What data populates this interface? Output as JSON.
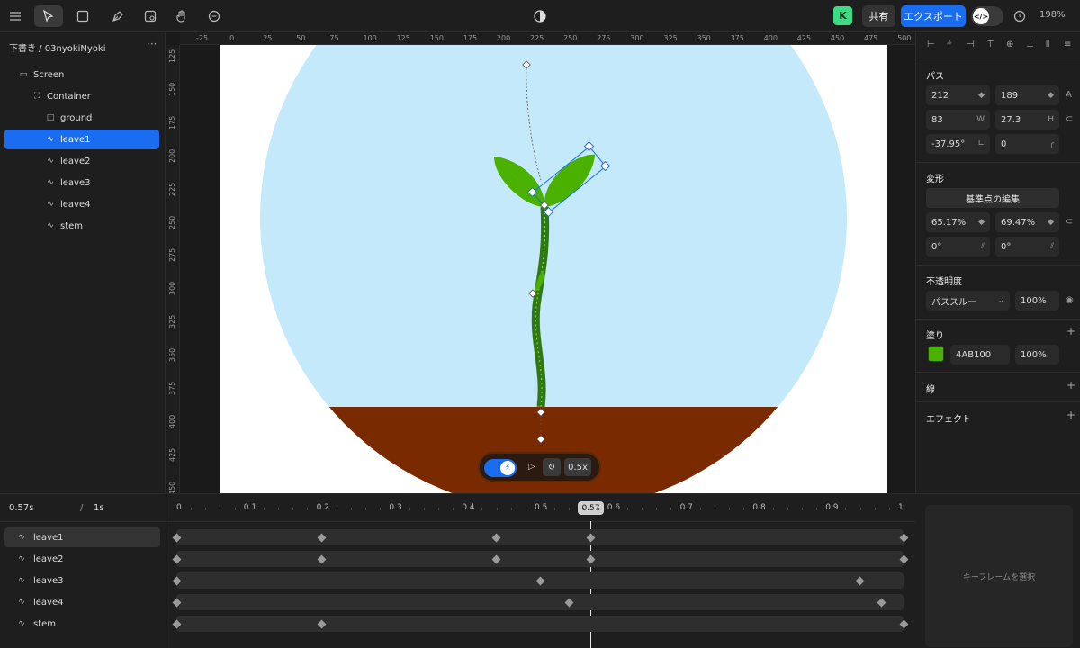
{
  "topbar": {
    "avatar_letter": "K",
    "share_label": "共有",
    "export_label": "エクスポート",
    "code_toggle_icon": "</>",
    "zoom": "198%"
  },
  "layers": {
    "breadcrumb": "下書き / 03nyokiNyoki",
    "more": "···",
    "items": [
      {
        "label": "Screen",
        "icon": "screen-icon"
      },
      {
        "label": "Container",
        "icon": "container-icon"
      },
      {
        "label": "ground",
        "icon": "rect-icon"
      },
      {
        "label": "leave1",
        "icon": "path-icon"
      },
      {
        "label": "leave2",
        "icon": "path-icon"
      },
      {
        "label": "leave3",
        "icon": "path-icon"
      },
      {
        "label": "leave4",
        "icon": "path-icon"
      },
      {
        "label": "stem",
        "icon": "path-icon"
      }
    ],
    "selected": "leave1"
  },
  "ruler": {
    "h_labels": [
      "-25",
      "0",
      "25",
      "50",
      "75",
      "100",
      "125",
      "150",
      "175",
      "200",
      "225",
      "250",
      "275",
      "300",
      "325",
      "350",
      "375",
      "400",
      "425",
      "450",
      "475",
      "500"
    ],
    "v_labels": [
      "125",
      "150",
      "175",
      "200",
      "225",
      "250",
      "275",
      "300",
      "325",
      "350",
      "375",
      "400",
      "425",
      "450"
    ]
  },
  "player": {
    "play_icon": "▷",
    "loop_icon": "↻",
    "speed": "0.5x"
  },
  "inspector": {
    "path_title": "パス",
    "x": "212",
    "y": "189",
    "w": "83",
    "w_suffix": "W",
    "h": "27.3",
    "h_suffix": "H",
    "rotation": "-37.95°",
    "radius": "0",
    "transform_title": "変形",
    "edit_origin_label": "基準点の編集",
    "scale_x": "65.17%",
    "scale_y": "69.47%",
    "skew_x": "0°",
    "skew_y": "0°",
    "opacity_title": "不透明度",
    "blend_mode": "パススルー",
    "opacity": "100%",
    "fill_title": "塗り",
    "fill_hex": "4AB100",
    "fill_color": "#4AB100",
    "fill_opacity": "100%",
    "stroke_title": "線",
    "effect_title": "エフェクト"
  },
  "timeline": {
    "current_time": "0.57s",
    "slash": "/",
    "duration": "1s",
    "ticks": [
      "0",
      "0.1",
      "0.2",
      "0.3",
      "0.4",
      "0.5",
      "0.6",
      "0.7",
      "0.8",
      "0.9",
      "1"
    ],
    "playhead_label": "0.57",
    "tracks": [
      {
        "label": "leave1",
        "keyframes": [
          0,
          0.2,
          0.44,
          0.57,
          1.0
        ]
      },
      {
        "label": "leave2",
        "keyframes": [
          0,
          0.2,
          0.44,
          0.57,
          1.0
        ]
      },
      {
        "label": "leave3",
        "keyframes": [
          0,
          0.5,
          0.94
        ]
      },
      {
        "label": "leave4",
        "keyframes": [
          0,
          0.54,
          0.97
        ]
      },
      {
        "label": "stem",
        "keyframes": [
          0,
          0.2,
          1.0
        ]
      }
    ],
    "keyframe_placeholder": "キーフレームを選択"
  },
  "colors": {
    "sky": "#C3E9FB",
    "ground": "#7A2A00",
    "plant": "#4AB100",
    "stem": "#2F7A10",
    "accent": "#1A6CF0"
  }
}
